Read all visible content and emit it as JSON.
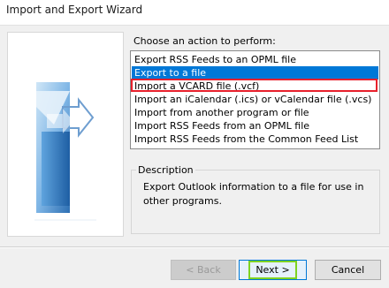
{
  "window": {
    "title": "Import and Export Wizard"
  },
  "prompt": "Choose an action to perform:",
  "actions": [
    {
      "label": "Export RSS Feeds to an OPML file",
      "selected": false
    },
    {
      "label": "Export to a file",
      "selected": true
    },
    {
      "label": "Import a VCARD file (.vcf)",
      "selected": false,
      "highlighted": true
    },
    {
      "label": "Import an iCalendar (.ics) or vCalendar file (.vcs)",
      "selected": false
    },
    {
      "label": "Import from another program or file",
      "selected": false
    },
    {
      "label": "Import RSS Feeds from an OPML file",
      "selected": false
    },
    {
      "label": "Import RSS Feeds from the Common Feed List",
      "selected": false
    }
  ],
  "description": {
    "heading": "Description",
    "text": "Export Outlook information to a file for use in other programs."
  },
  "buttons": {
    "back": "< Back",
    "next": "Next >",
    "cancel": "Cancel"
  },
  "colors": {
    "selection": "#0078d7",
    "highlight_box": "#e8202c",
    "next_focus": "#7ed321"
  }
}
